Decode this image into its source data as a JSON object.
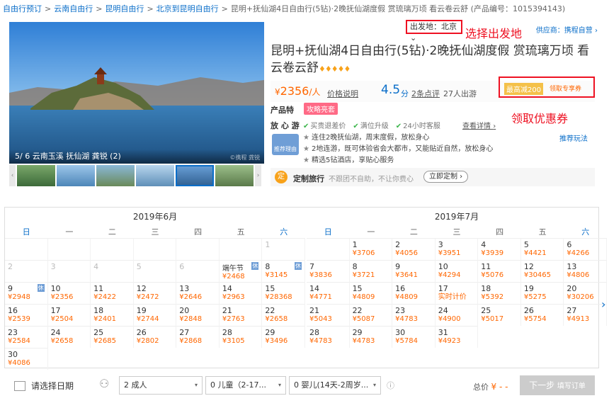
{
  "breadcrumb": {
    "items": [
      "自由行预订",
      "云南自由行",
      "昆明自由行",
      "北京到昆明自由行"
    ],
    "current": "昆明+抚仙湖4日自由行(5钻)·2晚抚仙湖度假 赏琉璃万顷 看云卷云舒 (产品编号：1015394143)"
  },
  "gallery": {
    "caption": "5/ 6 云南玉溪 抚仙湖 龚锐 (2)",
    "watermark": "©携程 龚锐",
    "prev": "‹",
    "next": "›"
  },
  "product": {
    "departure": "出发地：北京",
    "departure_caret": "⌄",
    "departure_annotation": "选择出发地",
    "supplier_label": "供应商：",
    "supplier_name": "携程自营",
    "supplier_arrow": "›",
    "title": "昆明+抚仙湖4日自由行(5钻)·2晚抚仙湖度假 赏琉璃万顷 看云卷云舒",
    "diamonds": "♦♦♦♦♦",
    "price_currency": "¥",
    "price": "2356",
    "price_unit": "/人",
    "price_note": "价格说明",
    "score": "4.5",
    "score_unit": "分",
    "reviews": "2条点评",
    "travelers": "27人出游",
    "coupon_tag": "最高减200",
    "coupon_link": "领取专享券",
    "coupon_annotation": "领取优惠券",
    "feature_label": "产品特",
    "feature_badge": "攻略亮套",
    "assure_label": "放 心 游",
    "assure_items": [
      "买贵退差价",
      "满位升级",
      "24小时客服"
    ],
    "assure_detail": "查看详情",
    "assure_arrow": "›",
    "reason_badge": "推荐理由",
    "reasons": [
      "连住2晚抚仙湖，周末度假，放松身心",
      "2地连游，既可体验省会大都市，又能贴近自然，放松身心",
      "精选5钻酒店，享贴心服务"
    ],
    "play": "推荐玩法",
    "custom_icon": "定",
    "custom_title": "定制旅行",
    "custom_sub": "不跟团不自助，不让你费心",
    "custom_button": "立即定制 ›"
  },
  "calendar": {
    "weekdays": [
      "日",
      "一",
      "二",
      "三",
      "四",
      "五",
      "六"
    ],
    "months": [
      {
        "title": "2019年6月",
        "days": [
          {
            "n": "",
            "p": ""
          },
          {
            "n": "",
            "p": ""
          },
          {
            "n": "",
            "p": ""
          },
          {
            "n": "",
            "p": ""
          },
          {
            "n": "",
            "p": ""
          },
          {
            "n": "",
            "p": ""
          },
          {
            "n": "1",
            "p": "",
            "d": true
          },
          {
            "n": "2",
            "p": "",
            "d": true
          },
          {
            "n": "3",
            "p": "",
            "d": true
          },
          {
            "n": "4",
            "p": "",
            "d": true
          },
          {
            "n": "5",
            "p": "",
            "d": true
          },
          {
            "n": "6",
            "p": "",
            "d": true
          },
          {
            "n": "",
            "p": "¥2468",
            "h": "端午节",
            "t": "休"
          },
          {
            "n": "8",
            "p": "¥3145",
            "t": "休"
          },
          {
            "n": "9",
            "p": "¥2948",
            "t": "休"
          },
          {
            "n": "10",
            "p": "¥2356"
          },
          {
            "n": "11",
            "p": "¥2422"
          },
          {
            "n": "12",
            "p": "¥2472"
          },
          {
            "n": "13",
            "p": "¥2646"
          },
          {
            "n": "14",
            "p": "¥2963"
          },
          {
            "n": "15",
            "p": "¥28368"
          },
          {
            "n": "16",
            "p": "¥2539"
          },
          {
            "n": "17",
            "p": "¥2504"
          },
          {
            "n": "18",
            "p": "¥2401"
          },
          {
            "n": "19",
            "p": "¥2744"
          },
          {
            "n": "20",
            "p": "¥2848"
          },
          {
            "n": "21",
            "p": "¥2763"
          },
          {
            "n": "22",
            "p": "¥2658"
          },
          {
            "n": "23",
            "p": "¥2584"
          },
          {
            "n": "24",
            "p": "¥2658"
          },
          {
            "n": "25",
            "p": "¥2685"
          },
          {
            "n": "26",
            "p": "¥2802"
          },
          {
            "n": "27",
            "p": "¥2868"
          },
          {
            "n": "28",
            "p": "¥3105"
          },
          {
            "n": "29",
            "p": "¥3496"
          },
          {
            "n": "30",
            "p": "¥4086"
          }
        ]
      },
      {
        "title": "2019年7月",
        "days": [
          {
            "n": "",
            "p": ""
          },
          {
            "n": "1",
            "p": "¥3706"
          },
          {
            "n": "2",
            "p": "¥4056"
          },
          {
            "n": "3",
            "p": "¥3951"
          },
          {
            "n": "4",
            "p": "¥3939"
          },
          {
            "n": "5",
            "p": "¥4421"
          },
          {
            "n": "6",
            "p": "¥4266"
          },
          {
            "n": "7",
            "p": "¥3836"
          },
          {
            "n": "8",
            "p": "¥3721"
          },
          {
            "n": "9",
            "p": "¥3641"
          },
          {
            "n": "10",
            "p": "¥4294"
          },
          {
            "n": "11",
            "p": "¥5076"
          },
          {
            "n": "12",
            "p": "¥30465"
          },
          {
            "n": "13",
            "p": "¥4806"
          },
          {
            "n": "14",
            "p": "¥4771"
          },
          {
            "n": "15",
            "p": "¥4809"
          },
          {
            "n": "16",
            "p": "¥4809"
          },
          {
            "n": "17",
            "p": "实时计价"
          },
          {
            "n": "18",
            "p": "¥5392"
          },
          {
            "n": "19",
            "p": "¥5275"
          },
          {
            "n": "20",
            "p": "¥30206"
          },
          {
            "n": "21",
            "p": "¥5043"
          },
          {
            "n": "22",
            "p": "¥5087"
          },
          {
            "n": "23",
            "p": "¥4783"
          },
          {
            "n": "24",
            "p": "¥4900"
          },
          {
            "n": "25",
            "p": "¥5017"
          },
          {
            "n": "26",
            "p": "¥5754"
          },
          {
            "n": "27",
            "p": "¥4913"
          },
          {
            "n": "28",
            "p": "¥4783"
          },
          {
            "n": "29",
            "p": "¥4783"
          },
          {
            "n": "30",
            "p": "¥5784"
          },
          {
            "n": "31",
            "p": "¥4923"
          }
        ]
      }
    ],
    "next_arrow": "›"
  },
  "booking": {
    "date_placeholder": "请选择日期",
    "adults": "2  成人",
    "children": "0  儿童（2-17...",
    "infants": "0  婴儿(14天-2周岁...",
    "caret": "▾",
    "info_icon": "ⓘ",
    "total_label": "总价",
    "total_value": "¥ - -",
    "next_button": "下一步",
    "next_button_sub": "填写订单"
  }
}
